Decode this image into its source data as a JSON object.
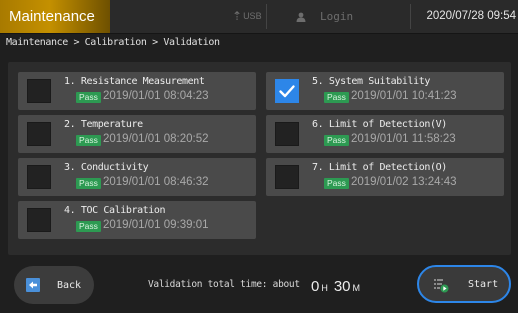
{
  "header": {
    "title": "Maintenance",
    "usb_label": "USB",
    "login_label": "Login",
    "datetime": "2020/07/28 09:54"
  },
  "breadcrumb": "Maintenance > Calibration > Validation",
  "items": [
    {
      "title": "1. Resistance Measurement",
      "status": "Pass",
      "time": "2019/01/01 08:04:23",
      "checked": false
    },
    {
      "title": "2. Temperature",
      "status": "Pass",
      "time": "2019/01/01 08:20:52",
      "checked": false
    },
    {
      "title": "3. Conductivity",
      "status": "Pass",
      "time": "2019/01/01 08:46:32",
      "checked": false
    },
    {
      "title": "4. TOC Calibration",
      "status": "Pass",
      "time": "2019/01/01 09:39:01",
      "checked": false
    },
    {
      "title": "5. System Suitability",
      "status": "Pass",
      "time": "2019/01/01 10:41:23",
      "checked": true
    },
    {
      "title": "6. Limit of Detection(V)",
      "status": "Pass",
      "time": "2019/01/01 11:58:23",
      "checked": false
    },
    {
      "title": "7. Limit of Detection(O)",
      "status": "Pass",
      "time": "2019/01/02 13:24:43",
      "checked": false
    }
  ],
  "footer": {
    "back_label": "Back",
    "total_label": "Validation total time:",
    "about_label": "about",
    "hours": "0",
    "hours_unit": "H",
    "minutes": "30",
    "minutes_unit": "M",
    "start_label": "Start"
  },
  "colors": {
    "accent": "#2d86e8",
    "pass": "#2d9a52",
    "title_tab": "#c49000"
  },
  "icons": {
    "usb": "usb-icon",
    "user": "user-icon",
    "check": "checkmark-icon",
    "back": "back-arrow-icon",
    "start": "start-play-icon"
  }
}
